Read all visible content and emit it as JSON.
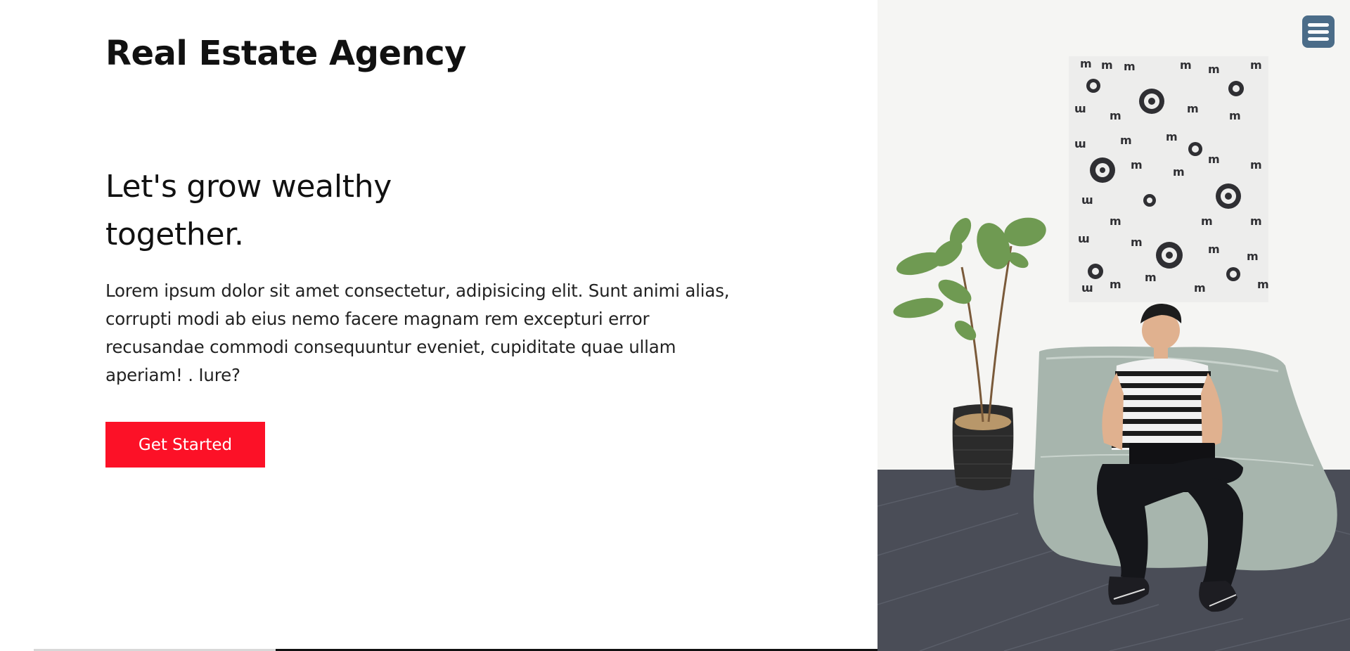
{
  "header": {
    "brand": "Real Estate Agency",
    "menu_icon": "hamburger-menu-icon"
  },
  "hero": {
    "headline_line1": "Let's grow wealthy",
    "headline_line2": "together.",
    "description": "Lorem ipsum dolor sit amet consectetur, adipisicing elit. Sunt animi alias, corrupti modi ab eius nemo facere magnam rem excepturi error recusandae commodi consequuntur eveniet, cupiditate quae ullam aperiam! . Iure?",
    "cta_label": "Get Started",
    "image_description_icon": "hero-photo"
  },
  "colors": {
    "accent": "#fc1127",
    "menu_button": "#4b6c88",
    "text": "#111111",
    "background": "#ffffff"
  }
}
